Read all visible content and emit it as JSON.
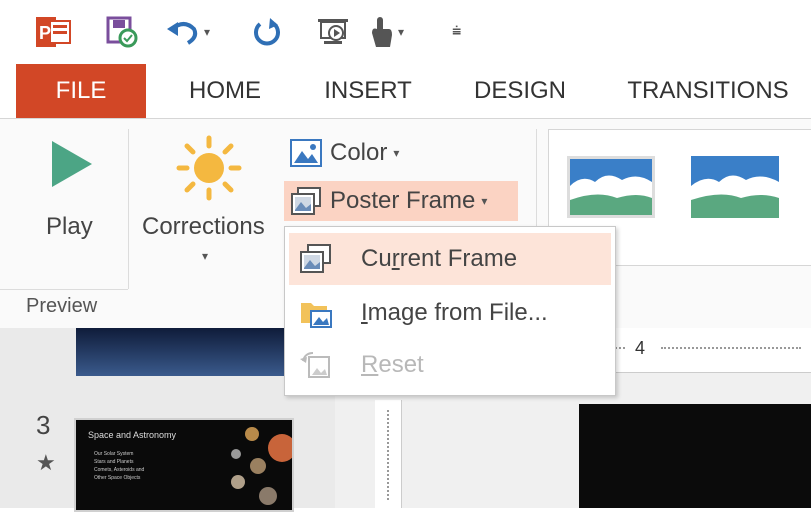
{
  "quick_access": {
    "app_icon": "powerpoint-icon",
    "items": [
      "save-sync-icon",
      "undo-icon",
      "redo-icon",
      "slideshow-from-start-icon",
      "touch-mode-icon"
    ],
    "app_letter": "P"
  },
  "tabs": [
    {
      "label": "FILE",
      "selected": true
    },
    {
      "label": "HOME"
    },
    {
      "label": "INSERT"
    },
    {
      "label": "DESIGN"
    },
    {
      "label": "TRANSITIONS"
    }
  ],
  "ribbon": {
    "play_label": "Play",
    "corrections_label": "Corrections",
    "color_label": "Color",
    "poster_frame_label": "Poster Frame",
    "preview_group_label": "Preview"
  },
  "menu": {
    "items": [
      {
        "prefix": "Cu",
        "underline": "r",
        "suffix": "rent Frame",
        "highlighted": true,
        "enabled": true
      },
      {
        "prefix": "",
        "underline": "I",
        "suffix": "mage from File...",
        "highlighted": false,
        "enabled": true
      },
      {
        "prefix": "",
        "underline": "R",
        "suffix": "eset",
        "highlighted": false,
        "enabled": false
      }
    ]
  },
  "slides": {
    "number": "3",
    "star": "★",
    "thumb_title": "Space and Astronomy",
    "thumb_bullets": [
      "Our Solar System",
      "Stars and Planets",
      "Comets, Asteroids and",
      "Other Space Objects"
    ]
  },
  "ruler": {
    "mark": "4"
  },
  "colors": {
    "file_tab": "#d24726",
    "menu_highlight": "#fde4d9",
    "ppt_red": "#d24726",
    "play_green": "#4ca585"
  }
}
